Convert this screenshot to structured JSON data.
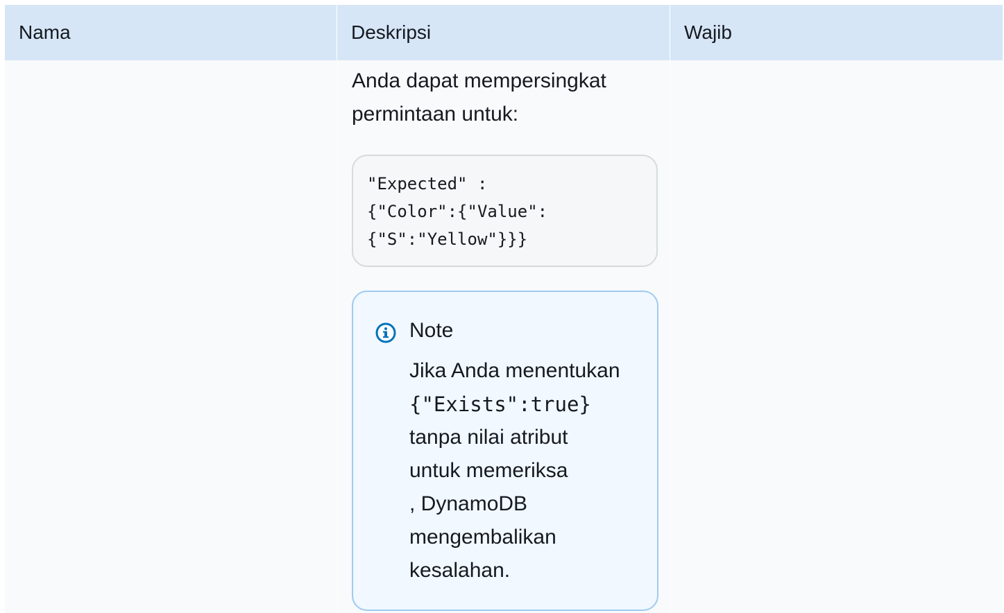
{
  "table": {
    "headers": {
      "name": "Nama",
      "description": "Deskripsi",
      "required": "Wajib"
    },
    "row": {
      "description": {
        "intro_line1": "Anda dapat mempersingkat",
        "intro_line2": "permintaan untuk:",
        "code_lines": [
          "\"Expected\" :",
          " {\"Color\":{\"Value\":",
          "{\"S\":\"Yellow\"}}}"
        ],
        "note": {
          "icon": "info-icon",
          "title": "Note",
          "line1": "Jika Anda menentukan",
          "code": "{\"Exists\":true}",
          "line3": "tanpa nilai atribut",
          "line4": "untuk memeriksa",
          "line5": ", DynamoDB",
          "line6": "mengembalikan",
          "line7": "kesalahan."
        }
      }
    }
  },
  "colors": {
    "header_bg": "#d6e6f7",
    "cell_bg": "#f9fafb",
    "code_bg": "#f6f7f8",
    "note_bg": "#f1f8ff",
    "note_border": "#9ecbf0",
    "info_icon": "#0073bb"
  }
}
